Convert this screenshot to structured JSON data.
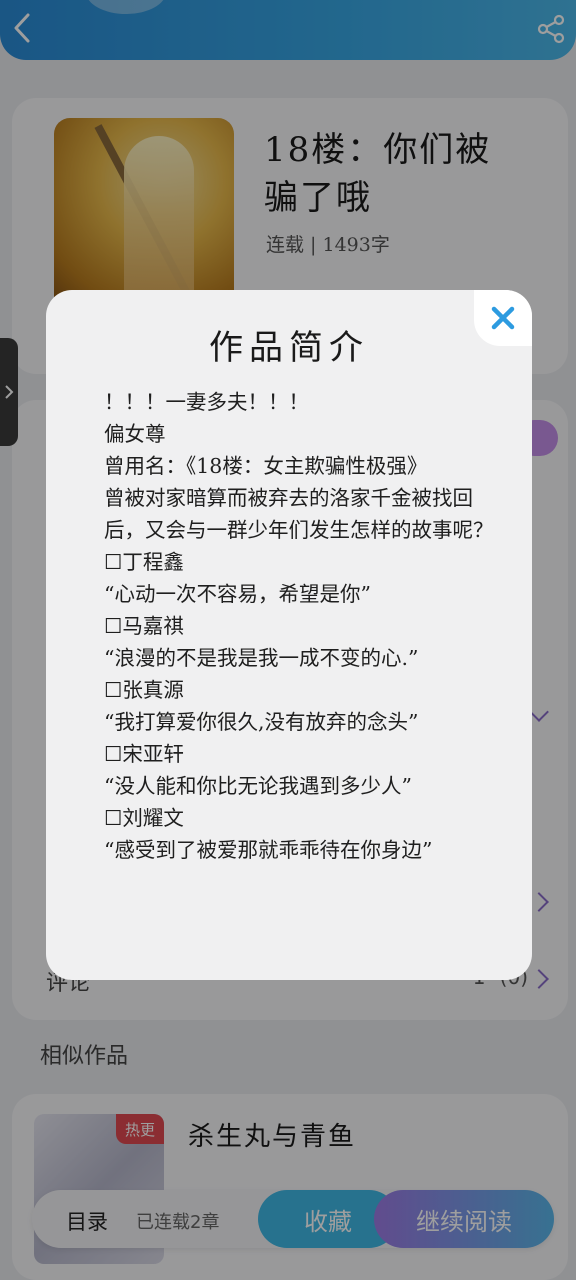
{
  "book": {
    "title": "18楼：你们被骗了哦",
    "status": "连载 | 1493字"
  },
  "similar": {
    "section_label": "相似作品",
    "badge": "热更",
    "title": "杀生丸与青鱼"
  },
  "info": {
    "comment_label": "评论",
    "comment_count": "1ᐩ (0)"
  },
  "bottom_bar": {
    "toc_label": "目录",
    "serial_label": "已连载2章",
    "favorite_label": "收藏",
    "continue_label": "继续阅读"
  },
  "modal": {
    "title": "作品简介",
    "lines": [
      "！！！一妻多夫！！！",
      "偏女尊",
      "曾用名：《18楼：女主欺骗性极强》",
      "曾被对家暗算而被弃去的洛家千金被找回后，又会与一群少年们发生怎样的故事呢？",
      "☐丁程鑫",
      "“心动一次不容易，希望是你”",
      "☐马嘉祺",
      "“浪漫的不是我是我一成不变的心.”",
      "☐张真源",
      "“我打算爱你很久,没有放弃的念头”",
      "☐宋亚轩",
      "“没人能和你比无论我遇到多少人”",
      "☐刘耀文",
      "“感受到了被爱那就乖乖待在你身边”"
    ]
  },
  "colors": {
    "topbar": "#2a8bd6",
    "accent_blue": "#3fb8e6",
    "accent_purple": "#9d7be6",
    "close_icon": "#2d9be0",
    "badge_red": "#e14a52"
  },
  "icons": {
    "back": "chevron-left-icon",
    "share": "share-icon",
    "close": "close-icon"
  }
}
